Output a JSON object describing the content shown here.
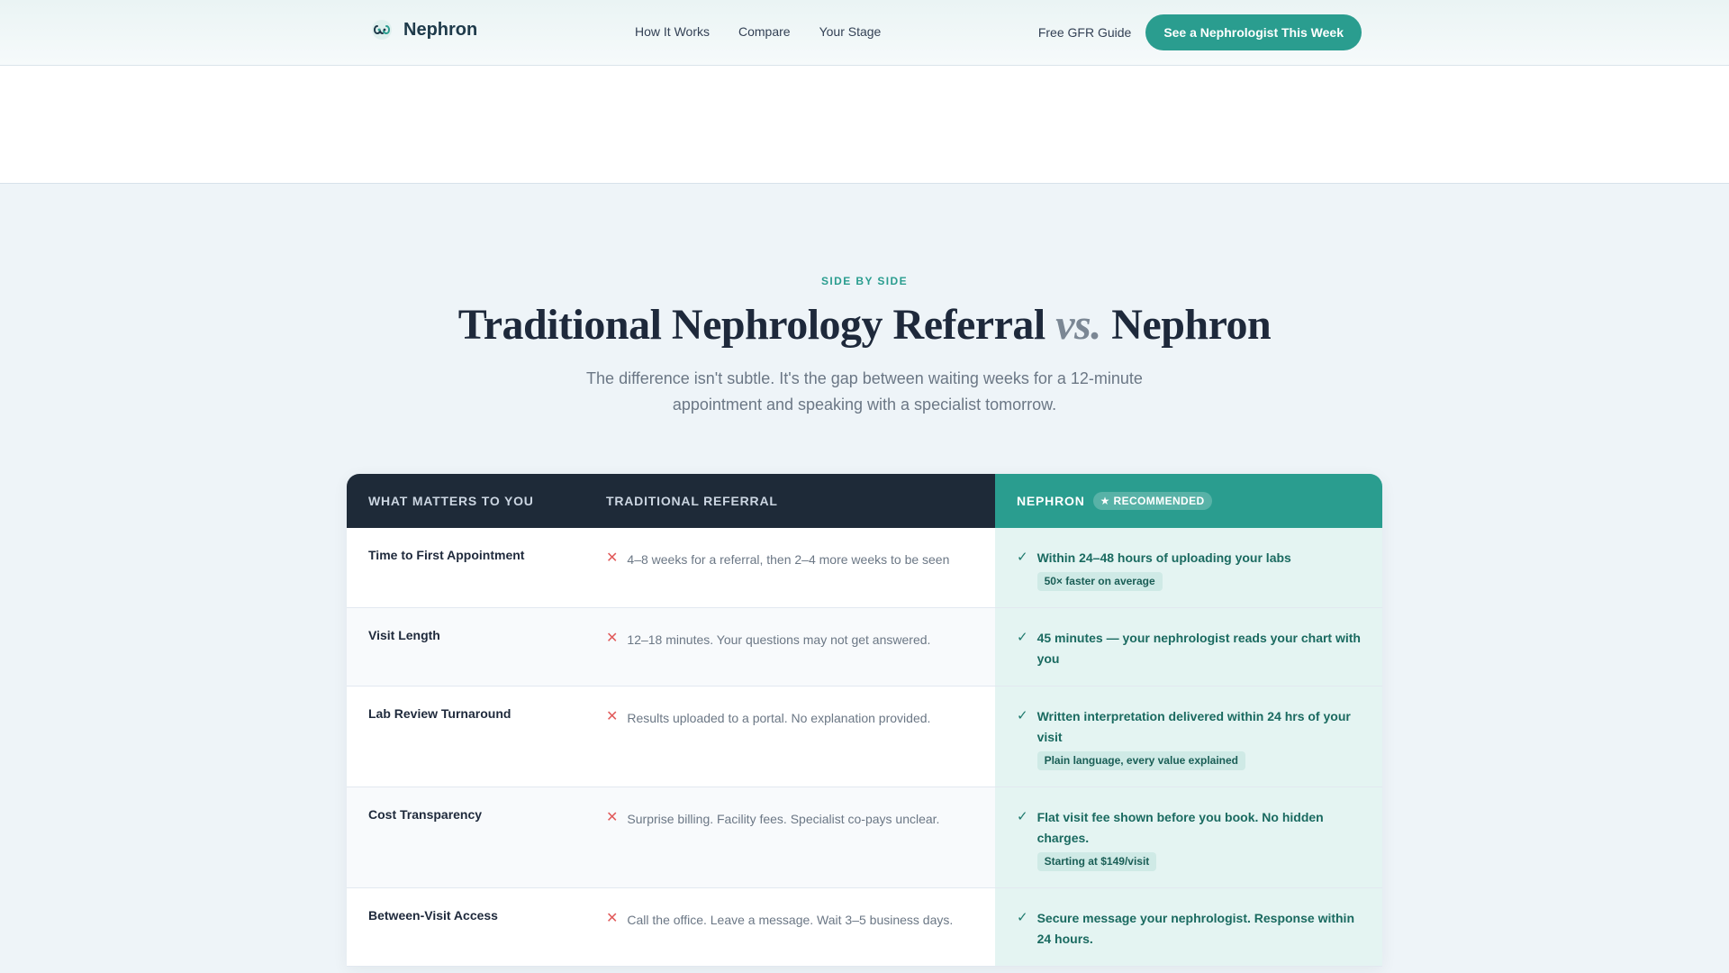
{
  "nav": {
    "brand": "Nephron",
    "links": [
      "How It Works",
      "Compare",
      "Your Stage"
    ],
    "guide": "Free GFR Guide",
    "cta": "See a Nephrologist This Week"
  },
  "hero": {
    "eyebrow": "SIDE BY SIDE",
    "title_left": "Traditional Nephrology Referral",
    "title_vs": "vs.",
    "title_right": "Nephron",
    "subtitle": "The difference isn't subtle. It's the gap between waiting weeks for a 12-minute appointment and speaking with a specialist tomorrow."
  },
  "table": {
    "headers": [
      "WHAT MATTERS TO YOU",
      "TRADITIONAL REFERRAL",
      "NEPHRON"
    ],
    "badge": "★ RECOMMENDED",
    "rows": [
      {
        "label": "Time to First Appointment",
        "traditional": "4–8 weeks for a referral, then 2–4 more weeks to be seen",
        "nephron": "Within 24–48 hours of uploading your labs",
        "pill": "50× faster on average"
      },
      {
        "label": "Visit Length",
        "traditional": "12–18 minutes. Your questions may not get answered.",
        "nephron": "45 minutes — your nephrologist reads your chart with you",
        "pill": ""
      },
      {
        "label": "Lab Review Turnaround",
        "traditional": "Results uploaded to a portal. No explanation provided.",
        "nephron": "Written interpretation delivered within 24 hrs of your visit",
        "pill": "Plain language, every value explained"
      },
      {
        "label": "Cost Transparency",
        "traditional": "Surprise billing. Facility fees. Specialist co-pays unclear.",
        "nephron": "Flat visit fee shown before you book. No hidden charges.",
        "pill": "Starting at $149/visit"
      },
      {
        "label": "Between-Visit Access",
        "traditional": "Call the office. Leave a message. Wait 3–5 business days.",
        "nephron": "Secure message your nephrologist. Response within 24 hours.",
        "pill": ""
      }
    ]
  }
}
